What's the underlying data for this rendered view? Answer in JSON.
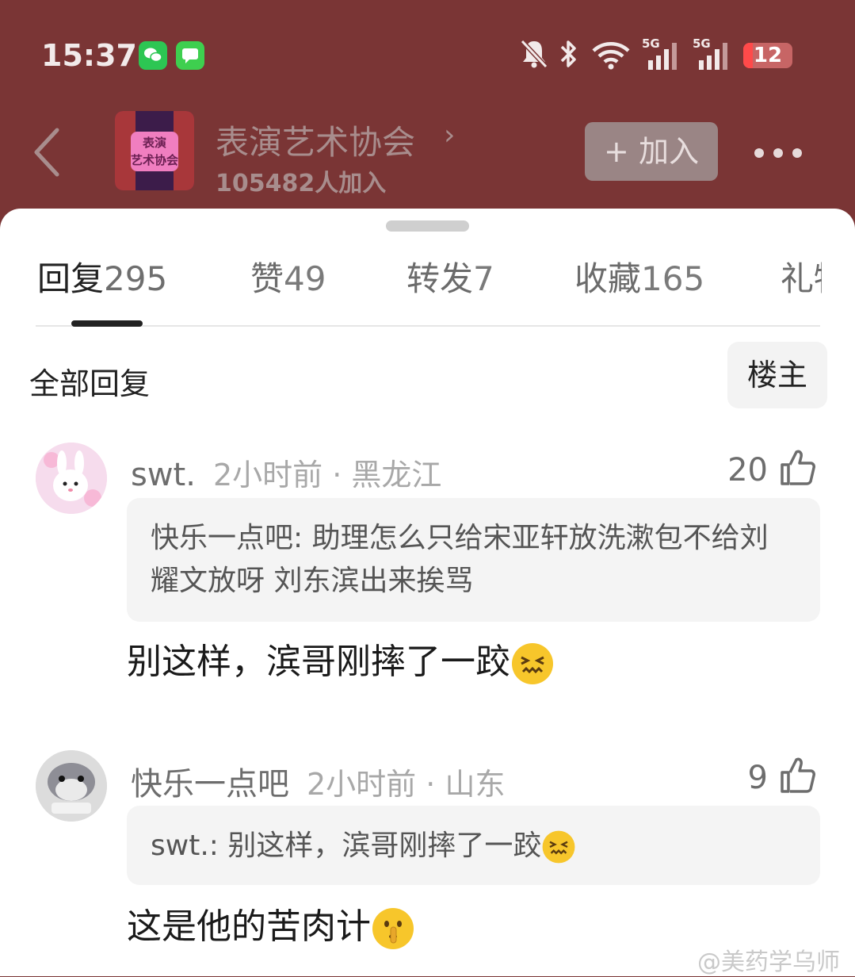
{
  "status_bar": {
    "time": "15:37",
    "network_1": "5G",
    "network_2": "5G",
    "battery": "12",
    "icons": [
      "wechat-icon",
      "message-icon",
      "mute-icon",
      "bluetooth-icon",
      "wifi-icon",
      "signal-icon",
      "battery-icon"
    ]
  },
  "header": {
    "group_name": "表演艺术协会",
    "group_avatar_text_1": "表演",
    "group_avatar_text_2": "艺术协会",
    "member_count": "105482人加入",
    "join_label": "+ 加入"
  },
  "tabs": [
    {
      "label": "回复",
      "count": "295"
    },
    {
      "label": "赞",
      "count": "49"
    },
    {
      "label": "转发",
      "count": "7"
    },
    {
      "label": "收藏",
      "count": "165"
    },
    {
      "label": "礼物",
      "count": ""
    }
  ],
  "filter": {
    "all_label": "全部回复",
    "owner_label": "楼主"
  },
  "comments": [
    {
      "user": "swt.",
      "time": "2小时前",
      "location": "黑龙江",
      "likes": "20",
      "quote": "快乐一点吧: 助理怎么只给宋亚轩放洗漱包不给刘耀文放呀 刘东滨出来挨骂",
      "text": "别这样，滨哥刚摔了一跤"
    },
    {
      "user": "快乐一点吧",
      "time": "2小时前",
      "location": "山东",
      "likes": "9",
      "quote": "swt.: 别这样，滨哥刚摔了一跤",
      "text": "这是他的苦肉计"
    }
  ],
  "watermark": "@美药学乌师",
  "colors": {
    "header_bg": "#7a3535",
    "sheet_bg": "#ffffff",
    "quote_bg": "#f4f4f4"
  }
}
